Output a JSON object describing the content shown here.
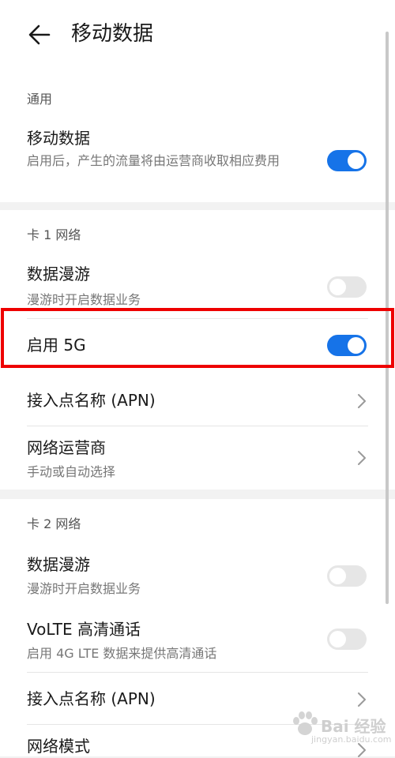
{
  "header": {
    "back_icon": "back-arrow-icon",
    "title": "移动数据"
  },
  "general": {
    "header": "通用",
    "mobile_data": {
      "title": "移动数据",
      "subtitle": "启用后，产生的流量将由运营商收取相应费用",
      "enabled": true
    }
  },
  "sim1": {
    "header": "卡 1 网络",
    "roaming": {
      "title": "数据漫游",
      "subtitle": "漫游时开启数据业务",
      "enabled": false
    },
    "enable_5g": {
      "title": "启用 5G",
      "enabled": true
    },
    "apn": {
      "title": "接入点名称 (APN)"
    },
    "operator": {
      "title": "网络运营商",
      "subtitle": "手动或自动选择"
    }
  },
  "sim2": {
    "header": "卡 2 网络",
    "roaming": {
      "title": "数据漫游",
      "subtitle": "漫游时开启数据业务",
      "enabled": false
    },
    "volte": {
      "title": "VoLTE 高清通话",
      "subtitle": "启用 4G LTE 数据来提供高清通话",
      "enabled": false
    },
    "apn": {
      "title": "接入点名称 (APN)"
    },
    "network_mode": {
      "title": "网络模式"
    }
  },
  "watermark": {
    "text": "Bai 经验",
    "sub": "jingyan.baidu.com"
  },
  "colors": {
    "accent": "#1673e8",
    "highlight": "#ee0000",
    "background": "#f2f2f2"
  }
}
